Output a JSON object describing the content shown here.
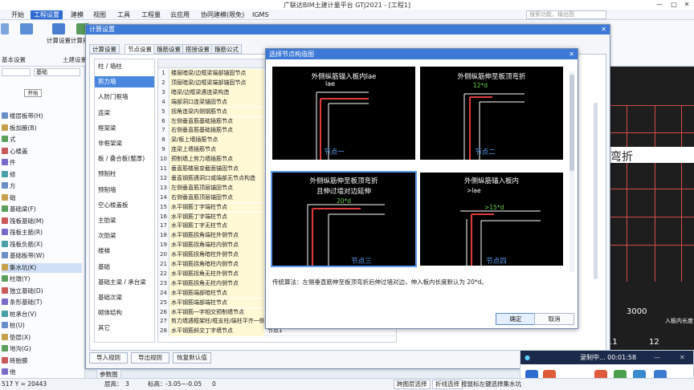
{
  "app": {
    "title": "广联达BIM土建计量平台 GTJ2021 - [工程1]",
    "window_controls": [
      "—",
      "□",
      "✕"
    ]
  },
  "menu": {
    "items": [
      "开始",
      "工程设置",
      "建模",
      "视图",
      "工具",
      "工程量",
      "云应用",
      "协同建模(限免)",
      "IGMS"
    ],
    "active_index": 1,
    "search_placeholder": "搜索功能，输出图"
  },
  "ribbon": {
    "buttons": [
      "计算设置",
      "计算规则"
    ],
    "groups": [
      "基本设置",
      "土建设置"
    ],
    "left_labels": [
      "基础"
    ],
    "tooltip": "开始"
  },
  "sidebar": {
    "items": [
      {
        "label": "楼层板带(H)"
      },
      {
        "label": "板加腋(B)"
      },
      {
        "label": "式"
      },
      {
        "label": "心楼盖"
      },
      {
        "label": "件"
      },
      {
        "label": "修"
      },
      {
        "label": "方"
      },
      {
        "label": "础"
      },
      {
        "label": "基础梁(F)"
      },
      {
        "label": "筏板基础(M)"
      },
      {
        "label": "筏板主筋(R)"
      },
      {
        "label": "筏板负筋(X)"
      },
      {
        "label": "基础板带(W)"
      },
      {
        "label": "集水坑(K)",
        "selected": true
      },
      {
        "label": "柱墩(Y)"
      },
      {
        "label": "独立基础(D)"
      },
      {
        "label": "条形基础(T)"
      },
      {
        "label": "桩承台(V)"
      },
      {
        "label": "桩(U)"
      },
      {
        "label": "垫层(X)"
      },
      {
        "label": "地沟(G)"
      },
      {
        "label": "砖胎膜"
      },
      {
        "label": "他"
      }
    ]
  },
  "dialog": {
    "title": "计算设置",
    "close": "✕",
    "tabs": [
      "计算设置",
      "节点设置",
      "箍筋设置",
      "搭接设置",
      "箍筋公式"
    ],
    "active_tab": 1,
    "categories": [
      "柱 / 墙柱",
      "剪力墙",
      "人防门框墙",
      "连梁",
      "框架梁",
      "非框架梁",
      "板 / 叠合板(整厚)",
      "预制柱",
      "预制墙",
      "空心楼盖板",
      "主肋梁",
      "次肋梁",
      "楼梯",
      "基础",
      "基础主梁 / 承台梁",
      "基础次梁",
      "砌体结构",
      "其它"
    ],
    "selected_category": 1,
    "table_header": "名称",
    "rows": [
      {
        "num": "1",
        "name": "楼层暗梁/边框梁端部锚固节点",
        "value": ""
      },
      {
        "num": "2",
        "name": "顶层暗梁/边框梁端部锚固节点",
        "value": ""
      },
      {
        "num": "3",
        "name": "暗梁/边框梁遇连梁构造",
        "value": ""
      },
      {
        "num": "4",
        "name": "端部洞口连梁锚固节点",
        "value": ""
      },
      {
        "num": "5",
        "name": "拐角连梁内侧钢筋节点",
        "value": ""
      },
      {
        "num": "6",
        "name": "左侧垂直筋基础插筋节点",
        "value": ""
      },
      {
        "num": "7",
        "name": "右侧垂直筋基础插筋节点",
        "value": ""
      },
      {
        "num": "8",
        "name": "梁/板上墙插筋节点",
        "value": ""
      },
      {
        "num": "9",
        "name": "连梁上墙插筋节点",
        "value": ""
      },
      {
        "num": "10",
        "name": "预制墙上剪力墙插筋节点",
        "value": ""
      },
      {
        "num": "11",
        "name": "垂直筋楼层变截面锚固节点",
        "value": ""
      },
      {
        "num": "12",
        "name": "垂直钢筋遇洞口或端部无节点构造",
        "value": ""
      },
      {
        "num": "13",
        "name": "左侧垂直筋顶层锚固节点",
        "value": ""
      },
      {
        "num": "14",
        "name": "右侧垂直筋顶层锚固节点",
        "value": ""
      },
      {
        "num": "15",
        "name": "水平钢筋丁字端柱节点",
        "value": ""
      },
      {
        "num": "16",
        "name": "水平钢筋丁字端柱节点",
        "value": ""
      },
      {
        "num": "17",
        "name": "水平钢筋丁字无柱节点",
        "value": ""
      },
      {
        "num": "18",
        "name": "水平钢筋拐角端柱外侧节点",
        "value": ""
      },
      {
        "num": "19",
        "name": "水平钢筋拐角端柱内侧节点",
        "value": ""
      },
      {
        "num": "20",
        "name": "水平钢筋拐角暗柱外侧节点",
        "value": ""
      },
      {
        "num": "21",
        "name": "水平钢筋拐角暗柱内侧节点",
        "value": ""
      },
      {
        "num": "22",
        "name": "水平钢筋拐角无柱外侧节点",
        "value": ""
      },
      {
        "num": "23",
        "name": "水平钢筋拐角无柱内侧节点",
        "value": ""
      },
      {
        "num": "24",
        "name": "水平钢筋端部暗柱节点",
        "value": ""
      },
      {
        "num": "25",
        "name": "水平钢筋端部端柱节点",
        "value": ""
      },
      {
        "num": "26",
        "name": "水平钢筋一字相交预制墙节点",
        "value": ""
      },
      {
        "num": "27",
        "name": "剪力墙遇框架柱/框支柱/端柱平齐一侧",
        "value": "节点2"
      },
      {
        "num": "28",
        "name": "水平钢筋斜交丁字墙节点",
        "value": "节点1"
      }
    ],
    "buttons": [
      "导入规则",
      "导出规则",
      "恢复默认值"
    ]
  },
  "node_dialog": {
    "title": "选择节点构造图",
    "close": "✕",
    "panels": [
      {
        "title": "外侧纵筋锚入板内lae",
        "dim": "lae",
        "label": "节点一"
      },
      {
        "title": "外侧纵筋伸至板顶弯折",
        "dim": "12*d",
        "label": "节点二"
      },
      {
        "title": "外侧纵筋伸至板顶弯折",
        "title2": "且伸过墙对边延伸",
        "dim": "20*d",
        "label": "节点三"
      },
      {
        "title": "外侧纵筋锚入板内",
        "dim": ">lae",
        "dim2": ">15*d",
        "label": "节点四"
      }
    ],
    "selected_panel": 2,
    "description": "传统算法：左侧垂直筋伸至板顶弯折后伸过墙对边，伸入板内长度默认为 20*d。",
    "buttons": [
      "确定",
      "取消"
    ]
  },
  "canvas": {
    "text_right": "弯折",
    "dims": [
      "3000",
      "11",
      "12"
    ],
    "side_text": "入板内长度"
  },
  "recorder": {
    "status": "录制中... 00:01:58"
  },
  "statusbar": {
    "coords": "517 Y = 20443",
    "floor_label": "层高：",
    "floor_value": "3",
    "elev_label": "标高：",
    "elev_value": "-3.05~-0.05",
    "value3": "0",
    "tools": [
      "跨图层选择",
      "折线选择",
      "按鼠标左键选择集水坑"
    ],
    "tab": "参数图"
  },
  "colors": {
    "accent": "#3d79d6",
    "selected_category": "#4a87df",
    "rebar_red": "#e03b3b",
    "panel_label": "#5b9cf0"
  }
}
